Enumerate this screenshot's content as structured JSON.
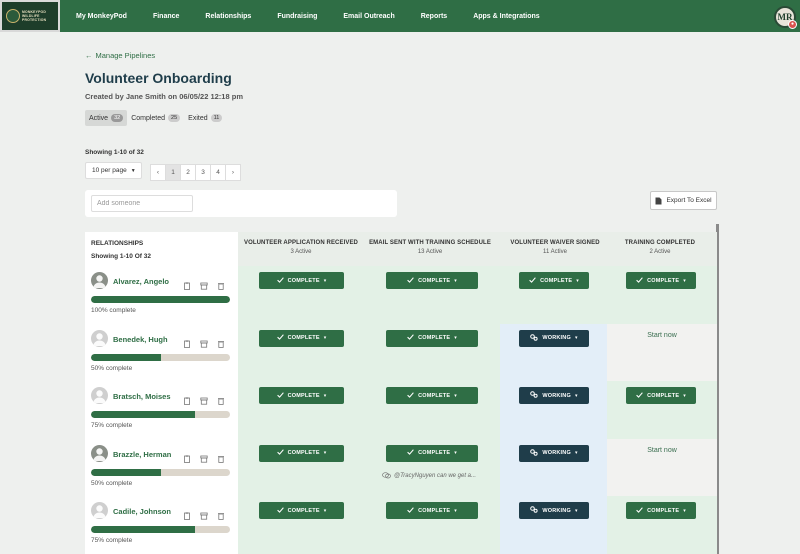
{
  "nav": {
    "logo_text": "MONKEYPOD WILDLIFE PROTECTION",
    "items": [
      "My MonkeyPod",
      "Finance",
      "Relationships",
      "Fundraising",
      "Email Outreach",
      "Reports",
      "Apps & Integrations"
    ],
    "avatar_initials": "MR"
  },
  "header": {
    "back_link": "Manage Pipelines",
    "title": "Volunteer Onboarding",
    "subtitle": "Created by Jane Smith on 06/05/22 12:18 pm",
    "tabs": [
      {
        "label": "Active",
        "count": "32"
      },
      {
        "label": "Completed",
        "count": "25"
      },
      {
        "label": "Exited",
        "count": "11"
      }
    ]
  },
  "list": {
    "showing": "Showing 1-10 of 32",
    "per_page": "10 per page",
    "pages": [
      "‹",
      "1",
      "2",
      "3",
      "4",
      "›"
    ],
    "search_placeholder": "Add someone",
    "export_label": "Export To Excel"
  },
  "board": {
    "relationships_title": "RELATIONSHIPS",
    "relationships_showing": "Showing 1-10 Of 32",
    "columns": [
      {
        "title": "VOLUNTEER APPLICATION RECEIVED",
        "sub": "3 Active"
      },
      {
        "title": "EMAIL SENT WITH TRAINING SCHEDULE",
        "sub": "13 Active"
      },
      {
        "title": "VOLUNTEER WAIVER SIGNED",
        "sub": "11 Active"
      },
      {
        "title": "TRAINING COMPLETED",
        "sub": "2 Active"
      }
    ],
    "status_labels": {
      "complete": "COMPLETE",
      "working": "WORKING",
      "start": "Start now"
    },
    "rows": [
      {
        "name": "Alvarez, Angelo",
        "progress": 100,
        "progress_label": "100% complete",
        "stages": [
          "complete",
          "complete",
          "complete",
          "complete"
        ]
      },
      {
        "name": "Benedek, Hugh",
        "progress": 50,
        "progress_label": "50% complete",
        "stages": [
          "complete",
          "complete",
          "working",
          "start"
        ]
      },
      {
        "name": "Bratsch, Moises",
        "progress": 75,
        "progress_label": "75% complete",
        "stages": [
          "complete",
          "complete",
          "working",
          "complete"
        ]
      },
      {
        "name": "Brazzle, Herman",
        "progress": 50,
        "progress_label": "50% complete",
        "stages": [
          "complete",
          "complete",
          "working",
          "start"
        ],
        "comment": "@TracyNguyen can we get a..."
      },
      {
        "name": "Cadile, Johnson",
        "progress": 75,
        "progress_label": "75% complete",
        "stages": [
          "complete",
          "complete",
          "working",
          "complete"
        ]
      }
    ]
  },
  "colors": {
    "nav_green": "#2f6e45",
    "complete_green": "#2f6e45",
    "working_navy": "#1f3d4a",
    "done_bg": "#e3f1e6",
    "working_bg": "#e3eef8"
  }
}
